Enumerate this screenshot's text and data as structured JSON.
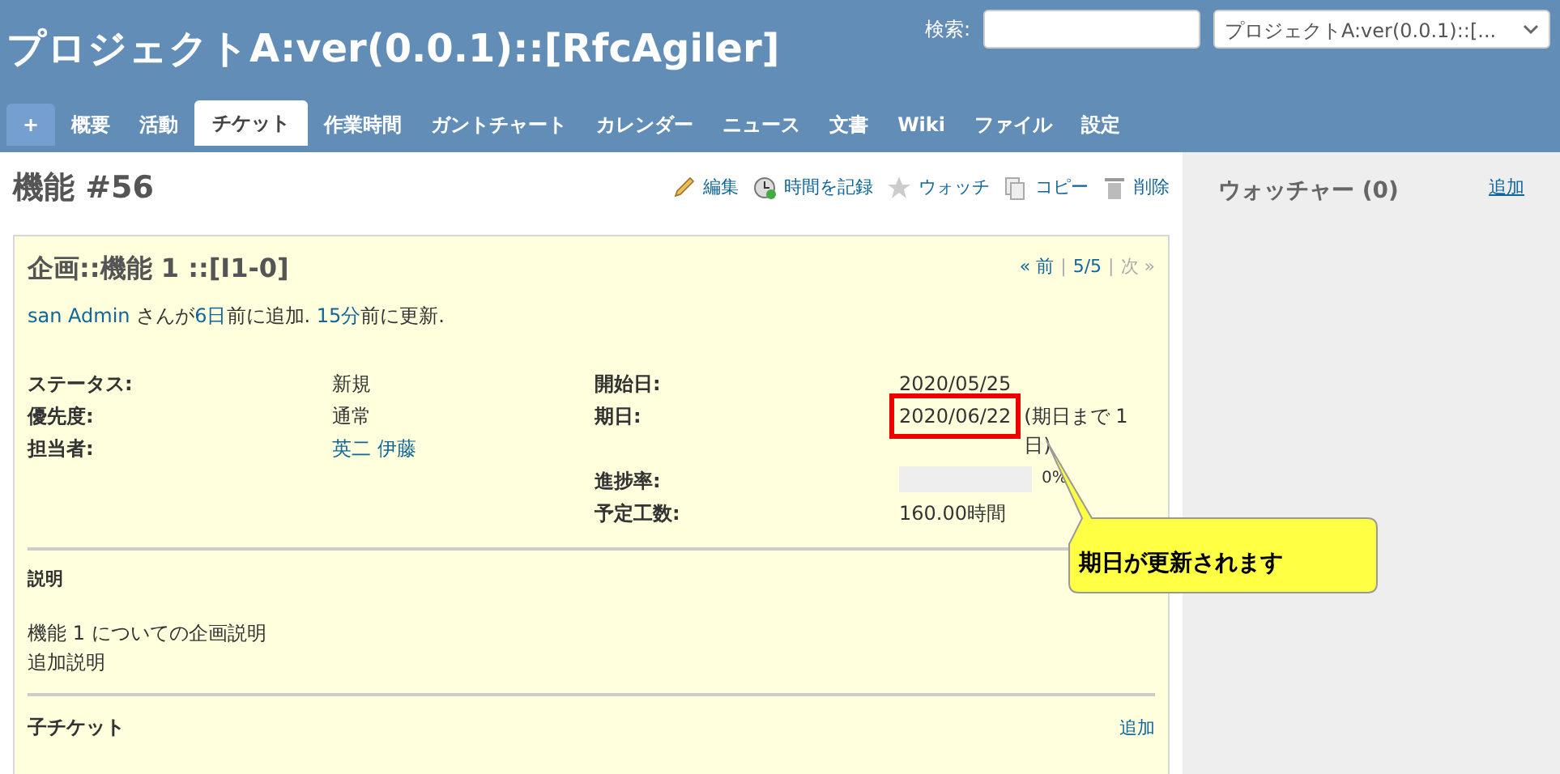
{
  "header": {
    "title": "プロジェクトA:ver(0.0.1)::[RfcAgiler]",
    "search_label": "検索:",
    "project_select": "プロジェクトA:ver(0.0.1)::[..."
  },
  "tabs": [
    {
      "label": "+",
      "kind": "new",
      "selected": false
    },
    {
      "label": "概要",
      "kind": "tab",
      "selected": false
    },
    {
      "label": "活動",
      "kind": "tab",
      "selected": false
    },
    {
      "label": "チケット",
      "kind": "tab",
      "selected": true
    },
    {
      "label": "作業時間",
      "kind": "tab",
      "selected": false
    },
    {
      "label": "ガントチャート",
      "kind": "tab",
      "selected": false
    },
    {
      "label": "カレンダー",
      "kind": "tab",
      "selected": false
    },
    {
      "label": "ニュース",
      "kind": "tab",
      "selected": false
    },
    {
      "label": "文書",
      "kind": "tab",
      "selected": false
    },
    {
      "label": "Wiki",
      "kind": "tab",
      "selected": false
    },
    {
      "label": "ファイル",
      "kind": "tab",
      "selected": false
    },
    {
      "label": "設定",
      "kind": "tab",
      "selected": false
    }
  ],
  "issue": {
    "title": "機能 #56",
    "actions": [
      {
        "label": "編集",
        "kind": "pencil"
      },
      {
        "label": "時間を記録",
        "kind": "clock"
      },
      {
        "label": "ウォッチ",
        "kind": "star"
      },
      {
        "label": "コピー",
        "kind": "copy"
      },
      {
        "label": "削除",
        "kind": "trash"
      }
    ],
    "subject": "企画::機能 1 ::[I1-0]",
    "nav": [
      {
        "label": "« 前",
        "kind": "link",
        "disabled": false
      },
      {
        "label": "|",
        "kind": "separator"
      },
      {
        "label": "5/5",
        "kind": "link",
        "disabled": false
      },
      {
        "label": "|",
        "kind": "separator"
      },
      {
        "label": "次 »",
        "kind": "link",
        "disabled": true
      }
    ],
    "author_line": [
      {
        "text": "san Admin",
        "link": true
      },
      {
        "text": " さんが",
        "link": false
      },
      {
        "text": "6日",
        "link": true
      },
      {
        "text": "前に追加. ",
        "link": false
      },
      {
        "text": "15分",
        "link": true
      },
      {
        "text": "前に更新.",
        "link": false
      }
    ],
    "attributes_left": [
      {
        "label": "ステータス:",
        "value": "新規",
        "link": false
      },
      {
        "label": "優先度:",
        "value": "通常",
        "link": false
      },
      {
        "label": "担当者:",
        "value": "英二 伊藤",
        "link": true
      }
    ],
    "attributes_right": [
      {
        "label": "開始日:",
        "kind": "text",
        "value": "2020/05/25"
      },
      {
        "label": "期日:",
        "kind": "date",
        "value": "2020/06/22",
        "note": "(期日まで 1日)",
        "highlighted": true
      },
      {
        "label": "進捗率:",
        "kind": "progress",
        "level": 0,
        "value": "0%"
      },
      {
        "label": "予定工数:",
        "kind": "text",
        "value": "160.00時間"
      }
    ],
    "description": {
      "title": "説明",
      "lines": [
        "機能 1 についての企画説明",
        "追加説明"
      ]
    },
    "subtasks": {
      "title": "子チケット",
      "add": "追加"
    }
  },
  "sidebar": {
    "title": "ウォッチャー (0)",
    "add": "追加"
  },
  "annotation": {
    "text": "期日が更新されます"
  }
}
